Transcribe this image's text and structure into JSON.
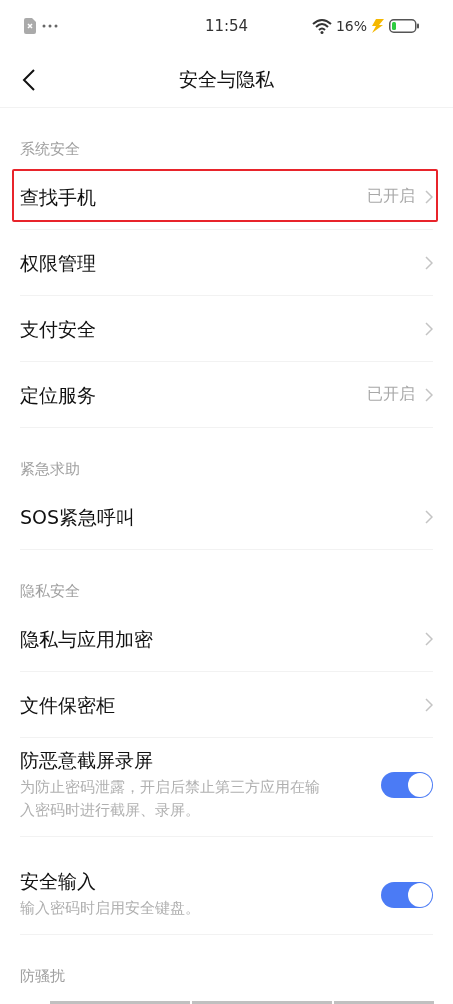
{
  "status_bar": {
    "time": "11:54",
    "battery": "16%"
  },
  "header": {
    "title": "安全与隐私"
  },
  "sections": [
    {
      "title": "系统安全",
      "items": [
        {
          "kind": "link",
          "label": "查找手机",
          "value": "已开启",
          "highlighted": true
        },
        {
          "kind": "link",
          "label": "权限管理",
          "highlighted": false
        },
        {
          "kind": "link",
          "label": "支付安全",
          "highlighted": false
        },
        {
          "kind": "link",
          "label": "定位服务",
          "value": "已开启",
          "highlighted": false
        }
      ]
    },
    {
      "title": "紧急求助",
      "items": [
        {
          "kind": "link",
          "label": "SOS紧急呼叫",
          "highlighted": false
        }
      ]
    },
    {
      "title": "隐私安全",
      "items": [
        {
          "kind": "link",
          "label": "隐私与应用加密",
          "highlighted": false
        },
        {
          "kind": "link",
          "label": "文件保密柜",
          "highlighted": false
        },
        {
          "kind": "toggle",
          "label": "防恶意截屏录屏",
          "description": "为防止密码泄露，开启后禁止第三方应用在输入密码时进行截屏、录屏。",
          "on": true,
          "highlighted": false
        },
        {
          "kind": "toggle",
          "label": "安全输入",
          "description": "输入密码时启用安全键盘。",
          "on": true,
          "highlighted": false
        }
      ]
    },
    {
      "title": "防骚扰"
    }
  ]
}
